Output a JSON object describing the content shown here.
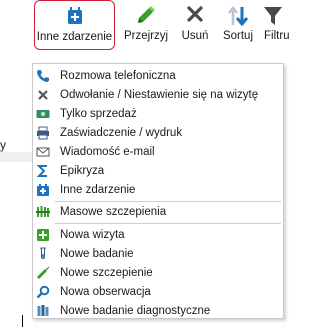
{
  "toolbar": {
    "buttons": [
      {
        "label": "Inne zdarzenie",
        "icon": "event-plus-icon"
      },
      {
        "label": "Przejrzyj",
        "icon": "pencil-icon"
      },
      {
        "label": "Usuń",
        "icon": "delete-x-icon"
      },
      {
        "label": "Sortuj",
        "icon": "sort-arrows-icon"
      },
      {
        "label": "Filtru",
        "icon": "filter-funnel-icon"
      }
    ]
  },
  "menu": {
    "items": [
      {
        "label": "Rozmowa telefoniczna",
        "icon": "phone-icon"
      },
      {
        "label": "Odwołanie / Niestawienie się na wizytę",
        "icon": "x-mark-icon"
      },
      {
        "label": "Tylko sprzedaż",
        "icon": "cash-icon"
      },
      {
        "label": "Zaświadczenie / wydruk",
        "icon": "printer-icon"
      },
      {
        "label": "Wiadomość e-mail",
        "icon": "envelope-icon"
      },
      {
        "label": "Epikryza",
        "icon": "sigma-icon"
      },
      {
        "label": "Inne zdarzenie",
        "icon": "event-plus-icon"
      },
      {
        "label": "Masowe szczepienia",
        "icon": "mass-vaccination-icon"
      },
      {
        "label": "Nowa wizyta",
        "icon": "new-visit-icon"
      },
      {
        "label": "Nowe badanie",
        "icon": "test-tube-icon"
      },
      {
        "label": "Nowe szczepienie",
        "icon": "syringe-icon"
      },
      {
        "label": "Nowa obserwacja",
        "icon": "magnifier-icon"
      },
      {
        "label": "Nowe badanie diagnostyczne",
        "icon": "diagnostic-tubes-icon"
      }
    ]
  },
  "background": {
    "fragment_letter": "y"
  },
  "colors": {
    "accent_red": "#d0213a",
    "icon_blue": "#1e73be",
    "icon_green": "#3aa02a"
  }
}
